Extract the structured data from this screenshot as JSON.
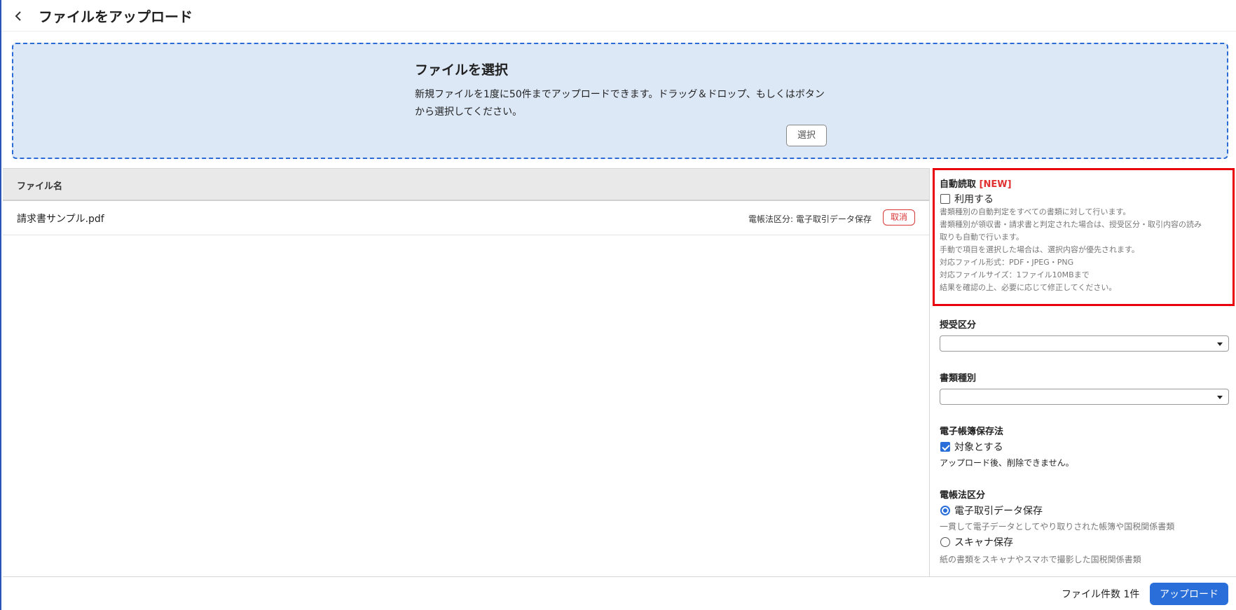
{
  "header": {
    "title": "ファイルをアップロード"
  },
  "dropzone": {
    "title": "ファイルを選択",
    "line1": "新規ファイルを1度に50件までアップロードできます。ドラッグ＆ドロップ、もしくはボタン",
    "line2": "から選択してください。",
    "select_label": "選択"
  },
  "table": {
    "column_name": "ファイル名",
    "rows": [
      {
        "name": "請求書サンプル.pdf",
        "category": "電帳法区分: 電子取引データ保存",
        "cancel_label": "取消"
      }
    ]
  },
  "panel": {
    "auto_read": {
      "title": "自動読取",
      "badge": "[NEW]",
      "checkbox_label": "利用する",
      "checked": false,
      "help": [
        "書類種別の自動判定をすべての書類に対して行います。",
        "書類種別が領収書・請求書と判定された場合は、授受区分・取引内容の読み",
        "取りも自動で行います。",
        "手動で項目を選択した場合は、選択内容が優先されます。",
        "対応ファイル形式：PDF・JPEG・PNG",
        "対応ファイルサイズ：1ファイル10MBまで",
        "結果を確認の上、必要に応じて修正してください。"
      ]
    },
    "exchange_type": {
      "label": "授受区分",
      "value": ""
    },
    "doc_type": {
      "label": "書類種別",
      "value": ""
    },
    "ebook_law": {
      "label": "電子帳簿保存法",
      "checkbox_label": "対象とする",
      "checked": true,
      "note": "アップロード後、削除できません。"
    },
    "ebook_category": {
      "label": "電帳法区分",
      "options": [
        {
          "label": "電子取引データ保存",
          "desc": "一貫して電子データとしてやり取りされた帳簿や国税関係書類",
          "selected": true
        },
        {
          "label": "スキャナ保存",
          "desc": "紙の書類をスキャナやスマホで撮影した国税関係書類",
          "selected": false
        }
      ]
    }
  },
  "footer": {
    "count_label": "ファイル件数 1件",
    "upload_label": "アップロード"
  },
  "colors": {
    "accent": "#2a6fd9",
    "highlight_border": "#e8000b",
    "dropzone_bg": "#dde8f7",
    "danger": "#d93636"
  }
}
